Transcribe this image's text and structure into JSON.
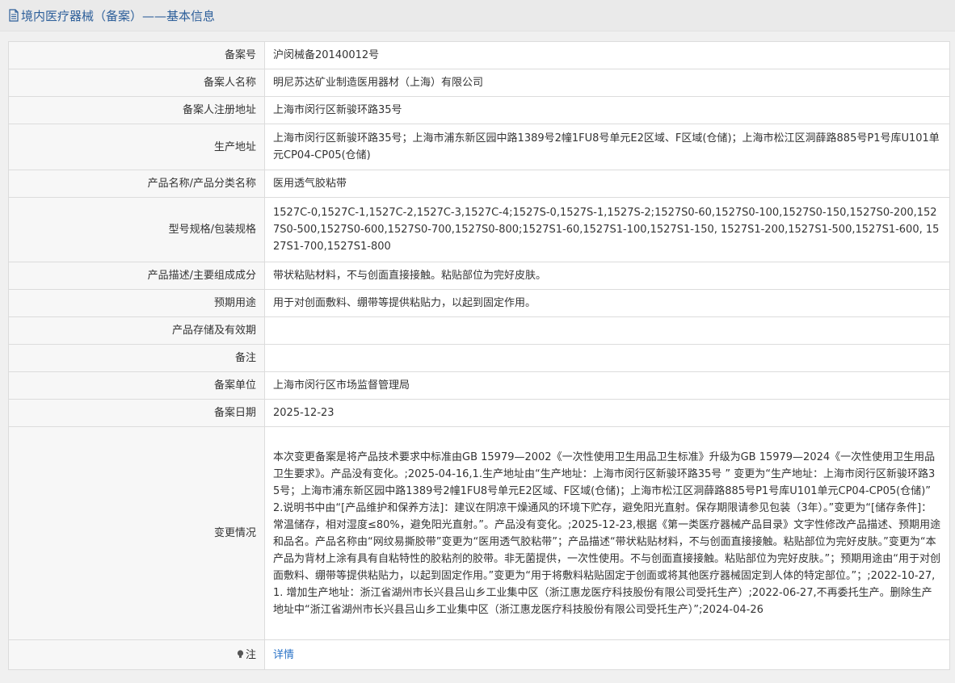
{
  "header": {
    "title": "境内医疗器械（备案）——基本信息",
    "icon": "document-icon"
  },
  "rows": [
    {
      "label": "备案号",
      "value": "沪闵械备20140012号"
    },
    {
      "label": "备案人名称",
      "value": "明尼苏达矿业制造医用器材（上海）有限公司"
    },
    {
      "label": "备案人注册地址",
      "value": "上海市闵行区新骏环路35号"
    },
    {
      "label": "生产地址",
      "value": "上海市闵行区新骏环路35号；上海市浦东新区园中路1389号2幢1FU8号单元E2区域、F区域(仓储)；上海市松江区洞薛路885号P1号库U101单元CP04-CP05(仓储)"
    },
    {
      "label": "产品名称/产品分类名称",
      "value": "医用透气胶粘带"
    },
    {
      "label": "型号规格/包装规格",
      "value": "1527C-0,1527C-1,1527C-2,1527C-3,1527C-4;1527S-0,1527S-1,1527S-2;1527S0-60,1527S0-100,1527S0-150,1527S0-200,1527S0-500,1527S0-600,1527S0-700,1527S0-800;1527S1-60,1527S1-100,1527S1-150, 1527S1-200,1527S1-500,1527S1-600, 1527S1-700,1527S1-800"
    },
    {
      "label": "产品描述/主要组成成分",
      "value": "带状粘贴材料，不与创面直接接触。粘贴部位为完好皮肤。"
    },
    {
      "label": "预期用途",
      "value": "用于对创面敷料、绷带等提供粘贴力，以起到固定作用。"
    },
    {
      "label": "产品存储及有效期",
      "value": ""
    },
    {
      "label": "备注",
      "value": ""
    },
    {
      "label": "备案单位",
      "value": "上海市闵行区市场监督管理局"
    },
    {
      "label": "备案日期",
      "value": "2025-12-23"
    },
    {
      "label": "变更情况",
      "value": "本次变更备案是将产品技术要求中标准由GB 15979—2002《一次性使用卫生用品卫生标准》升级为GB 15979—2024《一次性使用卫生用品卫生要求》。产品没有变化。;2025-04-16,1.生产地址由“生产地址：上海市闵行区新骏环路35号 ” 变更为“生产地址：上海市闵行区新骏环路35号；上海市浦东新区园中路1389号2幢1FU8号单元E2区域、F区域(仓储)；上海市松江区洞薛路885号P1号库U101单元CP04-CP05(仓储)” 2.说明书中由“[产品维护和保养方法]：建议在阴凉干燥通风的环境下贮存，避免阳光直射。保存期限请参见包装（3年）。”变更为“[储存条件]：常温储存，相对湿度≤80%，避免阳光直射。”。产品没有变化。;2025-12-23,根据《第一类医疗器械产品目录》文字性修改产品描述、预期用途和品名。产品名称由“网纹易撕胶带”变更为“医用透气胶粘带”；产品描述“带状粘贴材料，不与创面直接接触。粘贴部位为完好皮肤。”变更为“本产品为背材上涂有具有自粘特性的胶粘剂的胶带。非无菌提供，一次性使用。不与创面直接接触。粘贴部位为完好皮肤。”；预期用途由“用于对创面敷料、绷带等提供粘贴力，以起到固定作用。”变更为“用于将敷料粘贴固定于创面或将其他医疗器械固定到人体的特定部位。”；;2022-10-27,1. 增加生产地址：浙江省湖州市长兴县吕山乡工业集中区（浙江惠龙医疗科技股份有限公司受托生产）;2022-06-27,不再委托生产。删除生产地址中“浙江省湖州市长兴县吕山乡工业集中区（浙江惠龙医疗科技股份有限公司受托生产）”;2024-04-26"
    }
  ],
  "note": {
    "label": "注",
    "icon": "lightbulb-icon",
    "link_text": "详情"
  },
  "colors": {
    "title": "#2d5f9a",
    "link": "#2a73c7",
    "label_bg": "#f7f7f7",
    "border": "#dcdcdc"
  }
}
